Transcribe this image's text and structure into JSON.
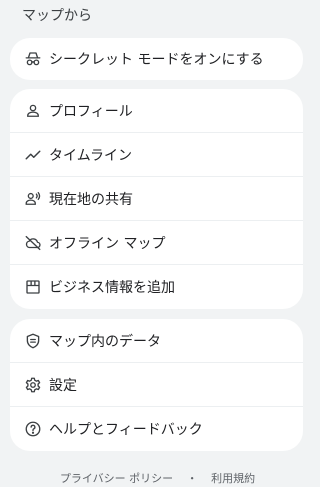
{
  "header": {
    "title": "マップから"
  },
  "incognito": {
    "label": "シークレット モードをオンにする",
    "icon": "incognito-icon"
  },
  "account_menu": {
    "items": [
      {
        "label": "プロフィール",
        "icon": "person-icon"
      },
      {
        "label": "タイムライン",
        "icon": "timeline-icon"
      },
      {
        "label": "現在地の共有",
        "icon": "location-sharing-icon"
      },
      {
        "label": "オフライン マップ",
        "icon": "offline-cloud-icon"
      },
      {
        "label": "ビジネス情報を追加",
        "icon": "storefront-icon"
      }
    ]
  },
  "settings_menu": {
    "items": [
      {
        "label": "マップ内のデータ",
        "icon": "data-shield-icon"
      },
      {
        "label": "設定",
        "icon": "gear-icon"
      },
      {
        "label": "ヘルプとフィードバック",
        "icon": "help-icon"
      }
    ]
  },
  "footer": {
    "privacy": "プライバシー ポリシー",
    "separator": "・",
    "terms": "利用規約"
  }
}
